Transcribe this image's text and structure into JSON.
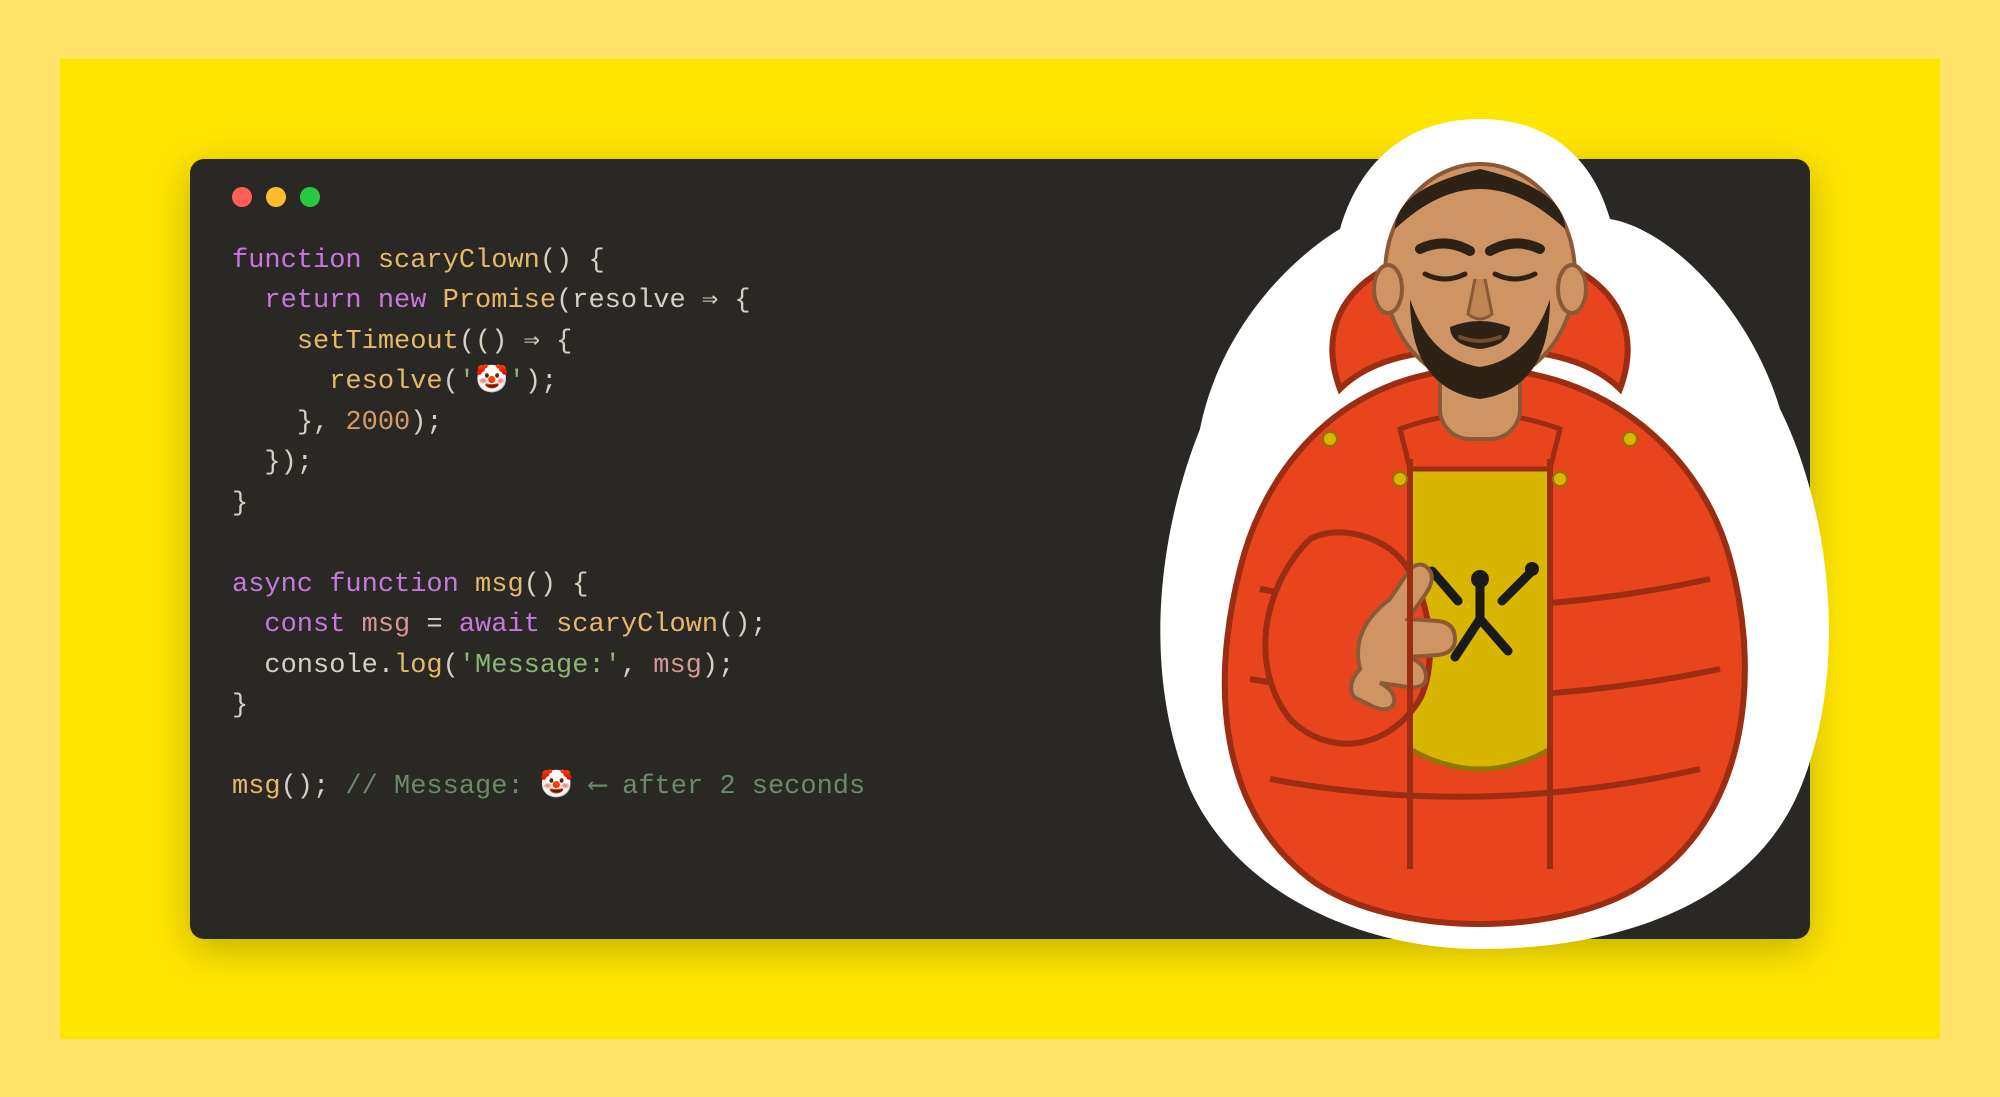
{
  "colors": {
    "outer_bg": "#ffe369",
    "inner_bg": "#ffe600",
    "editor_bg": "#2a2824",
    "dot_red": "#ff5f56",
    "dot_yellow": "#ffbd2e",
    "dot_green": "#27c93f"
  },
  "traffic_lights": [
    "red",
    "yellow",
    "green"
  ],
  "code": {
    "line1": {
      "kw_function": "function",
      "fn": "scaryClown",
      "parens": "()",
      "brace": " {"
    },
    "line2": {
      "kw_return": "return",
      "kw_new": "new",
      "cls": "Promise",
      "lparen": "(",
      "param": "resolve",
      "arrow": " ⇒ {"
    },
    "line3": {
      "fn": "setTimeout",
      "lparen": "((",
      "rparen": ")",
      "arrow": " ⇒ {"
    },
    "line4": {
      "fn": "resolve",
      "lparen": "(",
      "str": "'🤡'",
      "rparen": ");"
    },
    "line5": {
      "close": "}, ",
      "num": "2000",
      "rparen": ");"
    },
    "line6": {
      "close": "});"
    },
    "line7": {
      "close": "}"
    },
    "line9": {
      "kw_async": "async",
      "kw_function": "function",
      "fn": "msg",
      "parens": "()",
      "brace": " {"
    },
    "line10": {
      "kw_const": "const",
      "var": "msg",
      "eq": " = ",
      "kw_await": "await",
      "fn": "scaryClown",
      "call": "();"
    },
    "line11": {
      "obj": "console",
      "dot": ".",
      "method": "log",
      "lparen": "(",
      "str": "'Message:'",
      "comma": ", ",
      "var": "msg",
      "rparen": ");"
    },
    "line12": {
      "close": "}"
    },
    "line14": {
      "fn": "msg",
      "call": "();",
      "comment": " // Message: 🤡 ⟵ after 2 seconds"
    }
  },
  "sticker": {
    "name": "drake-approves-sticker",
    "jacket_color": "#e8451f",
    "shirt_color": "#d8b500"
  }
}
